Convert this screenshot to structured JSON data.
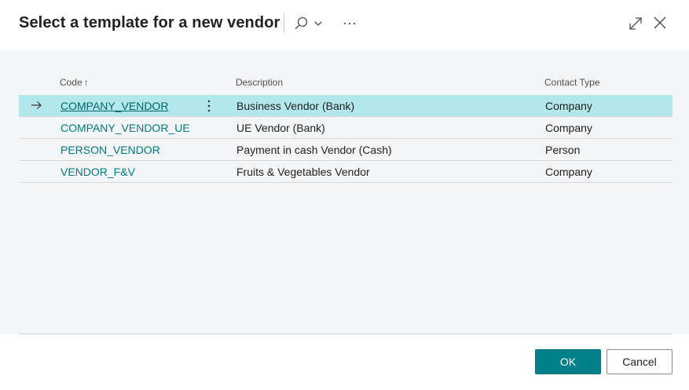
{
  "dialog": {
    "title": "Select a template for a new vendor"
  },
  "toolbar": {
    "search_icon": "search-icon",
    "chevron_icon": "chevron-down-icon",
    "more_icon": "more-options-icon",
    "expand_icon": "expand-icon",
    "close_icon": "close-icon"
  },
  "table": {
    "columns": {
      "code": "Code",
      "code_sort": "↑",
      "description": "Description",
      "contact_type": "Contact Type"
    },
    "rows": [
      {
        "code": "COMPANY_VENDOR",
        "description": "Business Vendor (Bank)",
        "contact_type": "Company",
        "selected": true
      },
      {
        "code": "COMPANY_VENDOR_UE",
        "description": "UE Vendor (Bank)",
        "contact_type": "Company",
        "selected": false
      },
      {
        "code": "PERSON_VENDOR",
        "description": "Payment in cash Vendor (Cash)",
        "contact_type": "Person",
        "selected": false
      },
      {
        "code": "VENDOR_F&V",
        "description": "Fruits & Vegetables Vendor",
        "contact_type": "Company",
        "selected": false
      }
    ]
  },
  "footer": {
    "ok_label": "OK",
    "cancel_label": "Cancel"
  },
  "colors": {
    "accent": "#00808a",
    "link": "#00797f",
    "selected_row": "#b2e7ec",
    "body_background": "#f4f5f7"
  }
}
